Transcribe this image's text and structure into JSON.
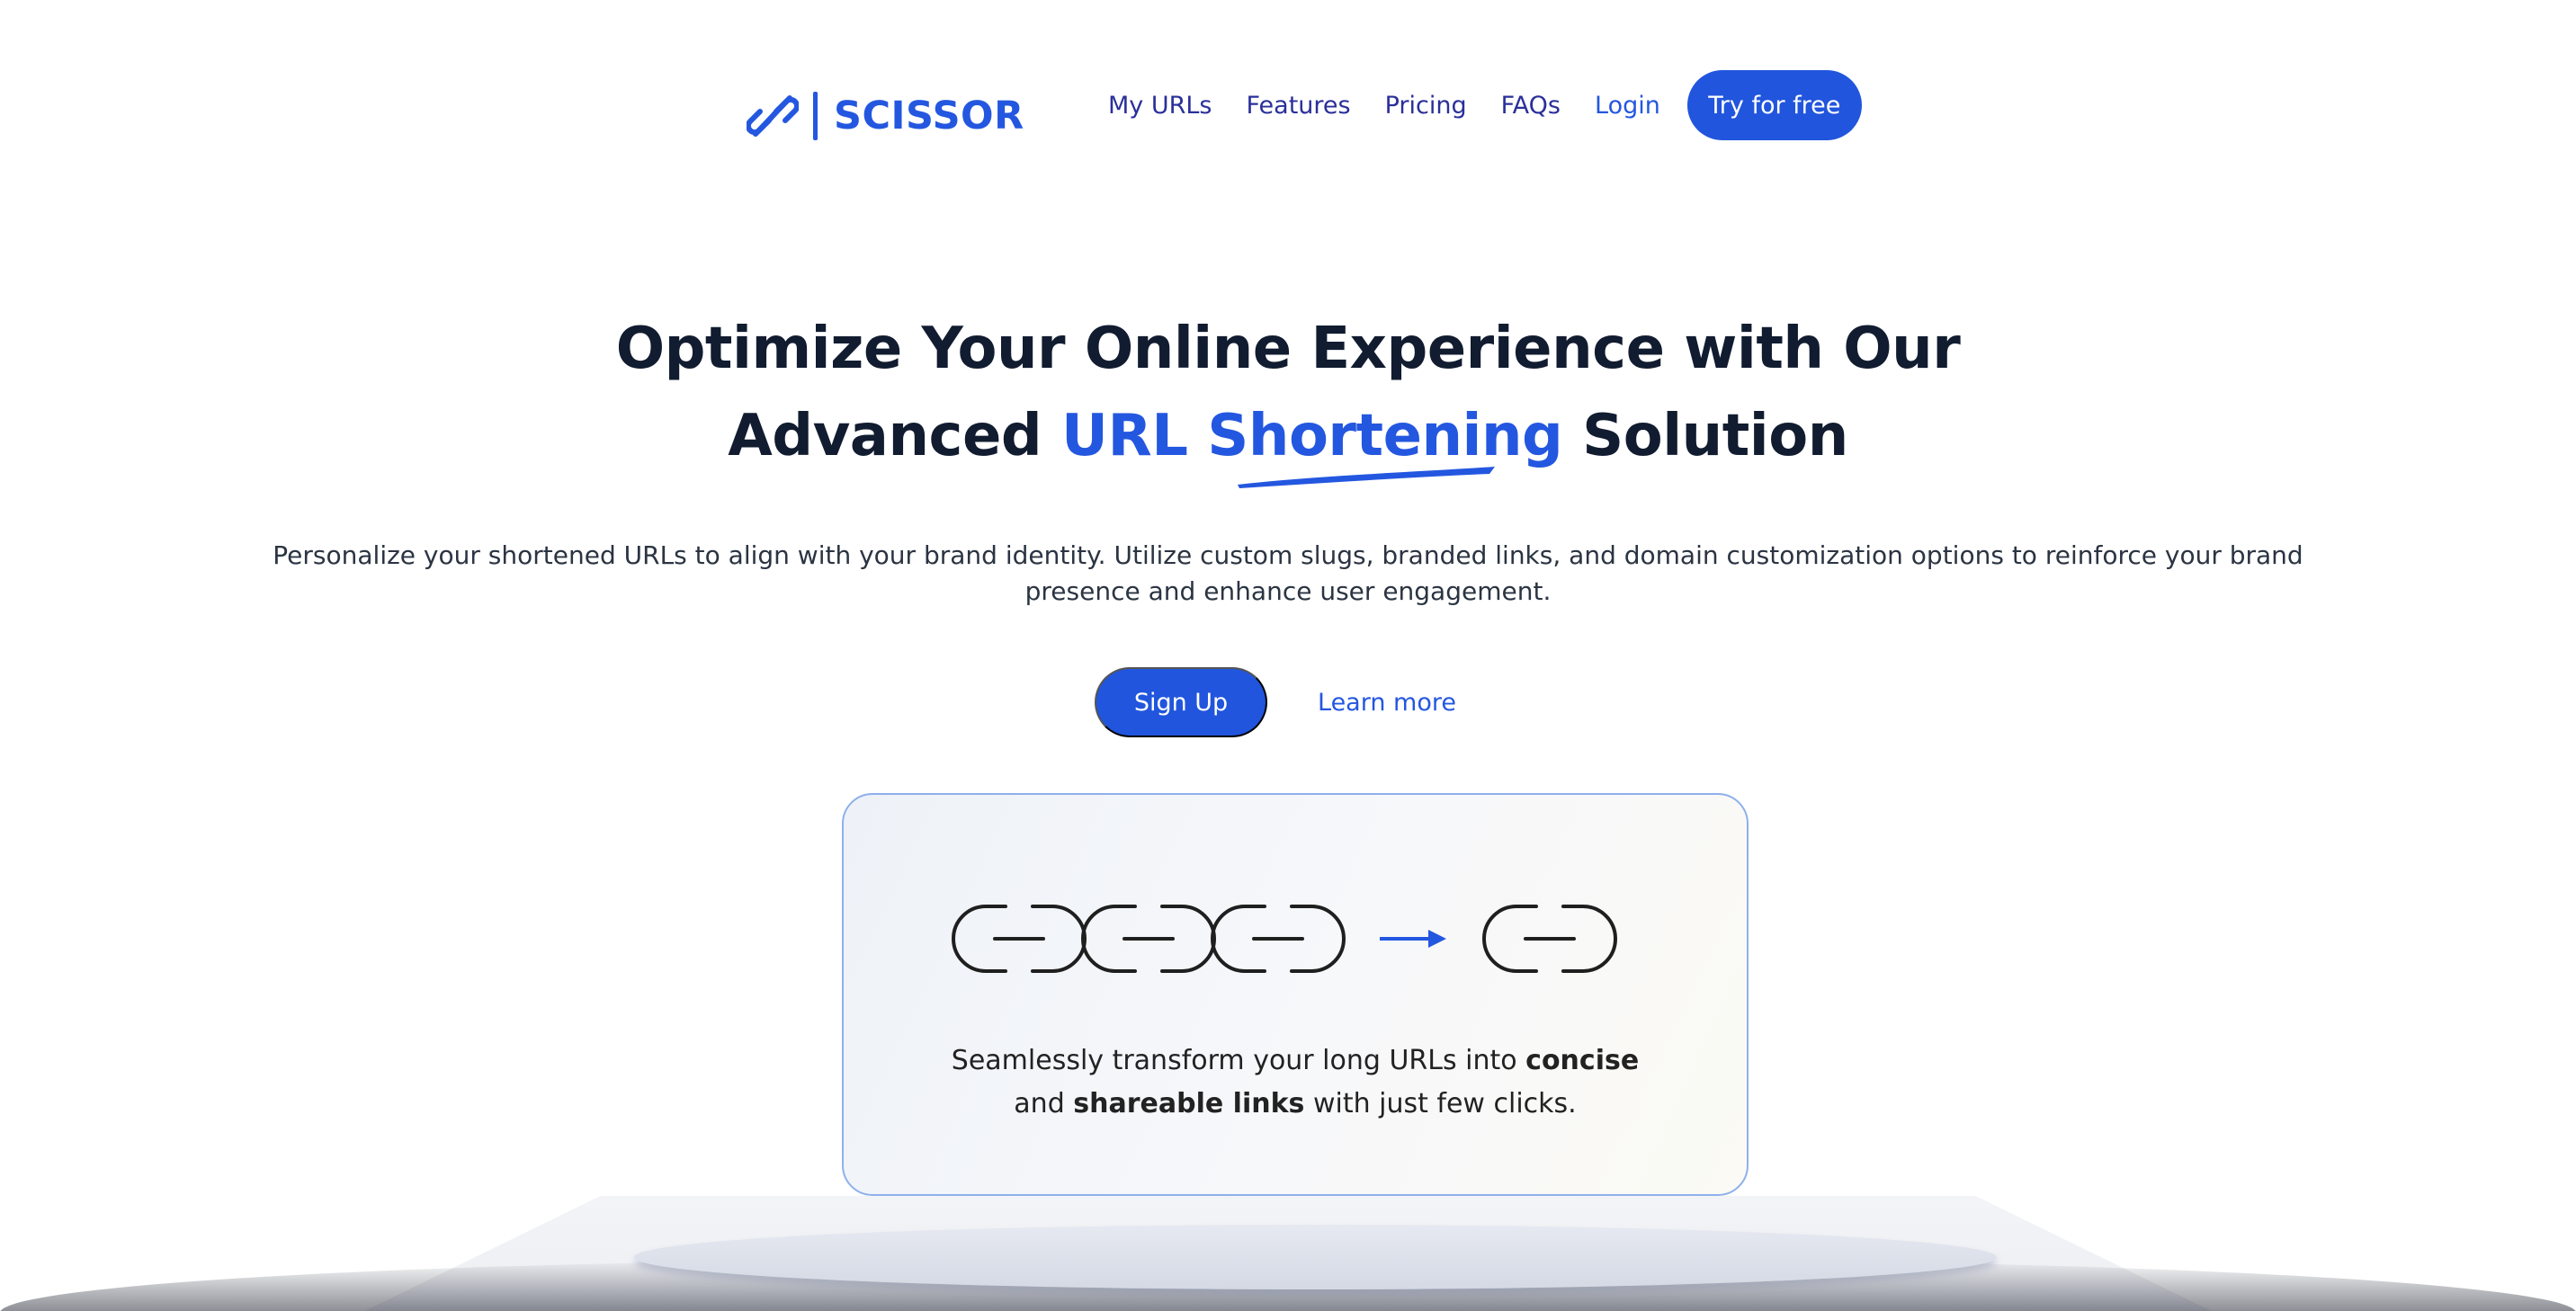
{
  "brand": {
    "name": "SCISSOR",
    "color": "#2457e0"
  },
  "nav": {
    "items": [
      {
        "label": "My URLs"
      },
      {
        "label": "Features"
      },
      {
        "label": "Pricing"
      },
      {
        "label": "FAQs"
      },
      {
        "label": "Login"
      }
    ],
    "cta_label": "Try for free"
  },
  "hero": {
    "title_line1": "Optimize Your Online Experience with Our",
    "title_line2_before": "Advanced ",
    "title_line2_accent": "URL Shortening",
    "title_line2_after": " Solution",
    "subtitle": "Personalize your shortened URLs to align with your brand identity. Utilize custom slugs, branded links, and domain customization options to reinforce your brand presence and enhance user engagement.",
    "signup_label": "Sign Up",
    "learn_more_label": "Learn more"
  },
  "card": {
    "line1_before": "Seamlessly transform your long URLs into ",
    "line1_bold": "concise",
    "line2_before": "and ",
    "line2_bold": "shareable links",
    "line2_after": " with just few clicks."
  },
  "icons": {
    "logo": "link-icon",
    "long_chain": "chain-links-icon",
    "arrow": "arrow-right-icon",
    "short_link": "short-link-icon"
  }
}
